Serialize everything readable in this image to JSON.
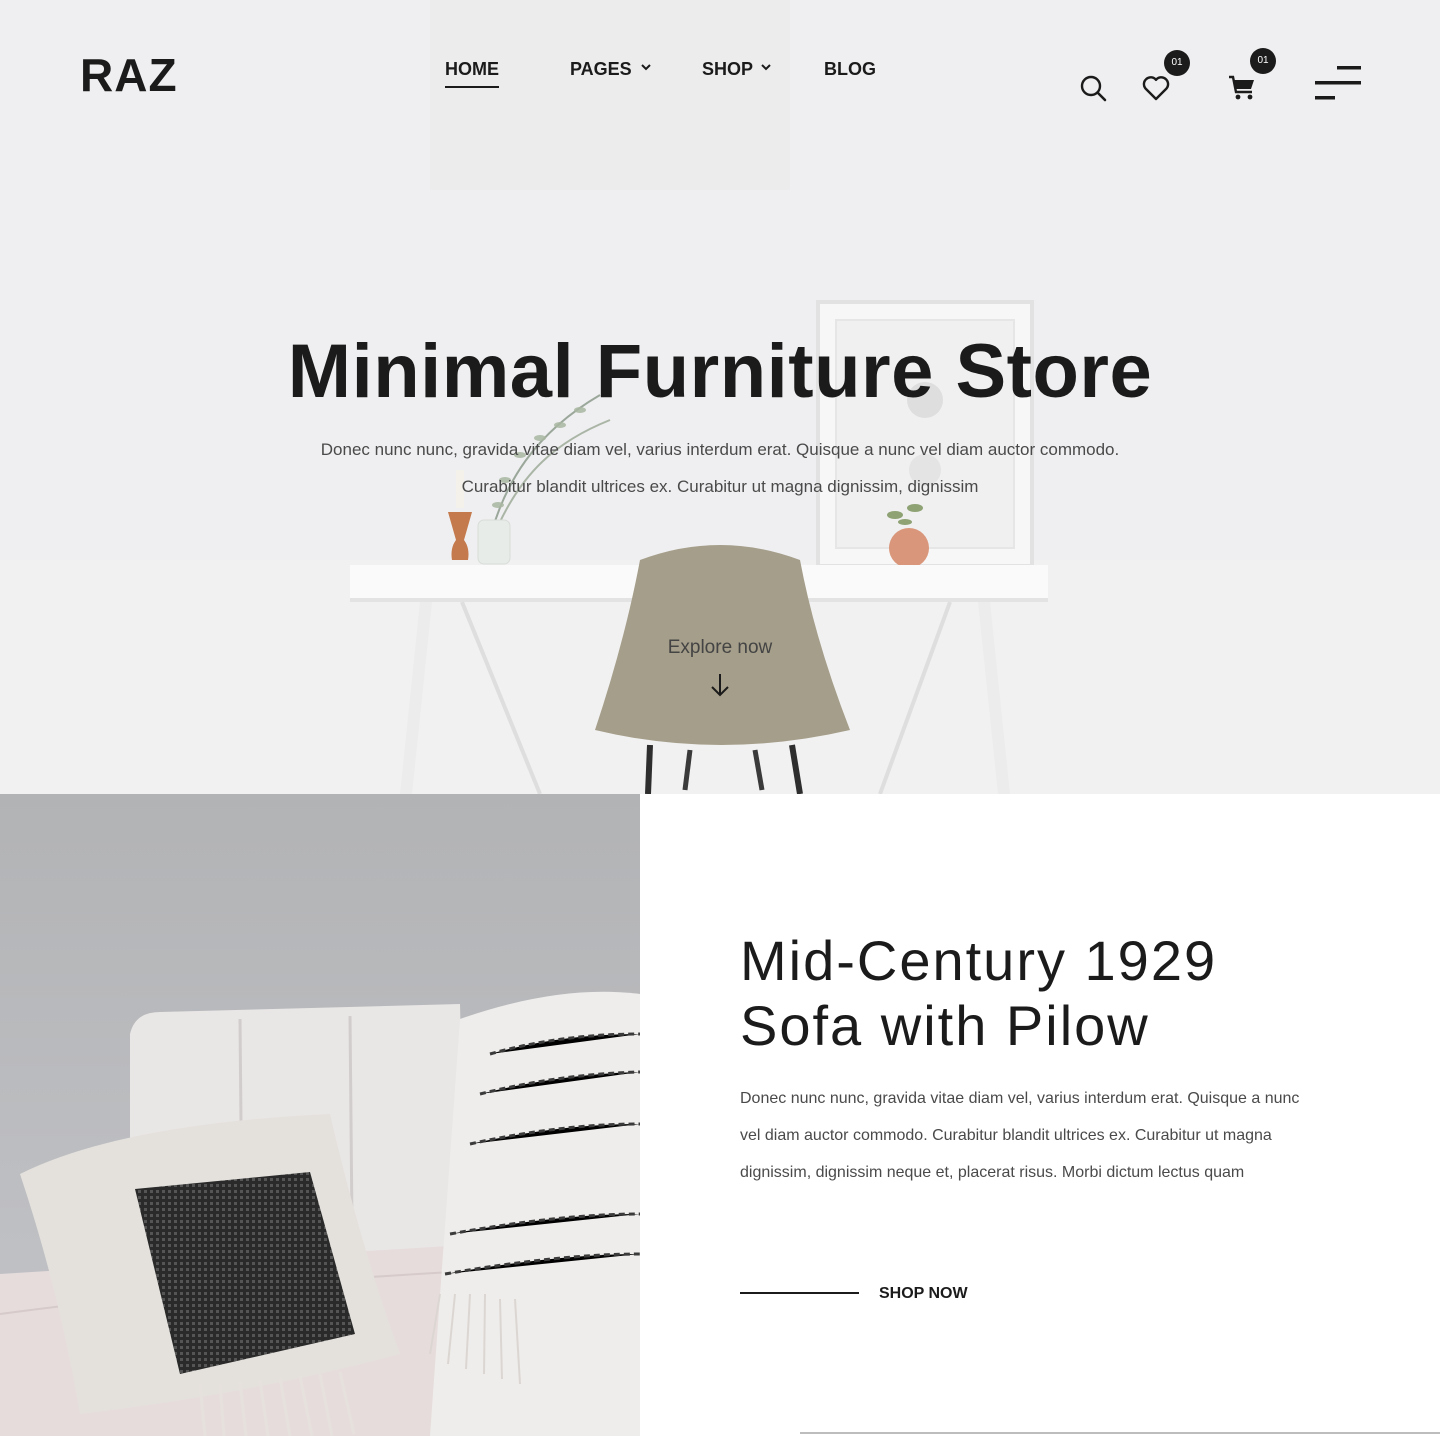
{
  "header": {
    "logo": "RAZ",
    "nav": [
      {
        "label": "HOME",
        "active": true,
        "has_dropdown": false
      },
      {
        "label": "PAGES",
        "active": false,
        "has_dropdown": true
      },
      {
        "label": "SHOP",
        "active": false,
        "has_dropdown": true
      },
      {
        "label": "BLOG",
        "active": false,
        "has_dropdown": false
      }
    ],
    "icons": {
      "search": "search-icon",
      "wishlist": "heart-icon",
      "cart": "cart-icon",
      "menu": "menu-icon"
    },
    "wishlist_count": "01",
    "cart_count": "01"
  },
  "hero": {
    "title": "Minimal Furniture Store",
    "text_line1": "Donec nunc nunc, gravida vitae diam vel, varius interdum erat. Quisque a nunc vel diam auctor commodo.",
    "text_line2": "Curabitur blandit ultrices ex. Curabitur ut magna dignissim, dignissim",
    "explore_label": "Explore now",
    "explore_icon": "arrow-down-icon"
  },
  "feature": {
    "title_line1": "Mid-Century 1929",
    "title_line2": "Sofa with Pilow",
    "text": "Donec nunc nunc, gravida vitae diam vel, varius interdum erat. Quisque a nunc vel diam auctor commodo. Curabitur blandit ultrices ex. Curabitur ut magna dignissim, dignissim neque et, placerat risus. Morbi dictum lectus quam",
    "cta_label": "SHOP NOW"
  },
  "colors": {
    "text_dark": "#1b1b1b",
    "text_body": "#4a4a4a",
    "badge_bg": "#1b1b1b",
    "chair": "#a59e8a"
  }
}
